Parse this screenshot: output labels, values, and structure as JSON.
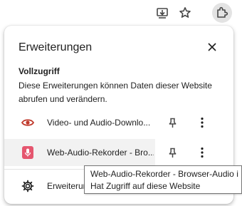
{
  "toolbar": {
    "buttons": [
      {
        "icon": "download-icon"
      },
      {
        "icon": "star-icon"
      },
      {
        "icon": "puzzle-icon"
      }
    ]
  },
  "panel": {
    "title": "Erweiterungen",
    "section_heading": "Vollzugriff",
    "section_description": "Diese Erweiterungen können Daten dieser Website abrufen und verändern.",
    "extensions": [
      {
        "name": "Video- und Audio-Downlo...",
        "icon": "eye-icon",
        "icon_color": "#c0392b"
      },
      {
        "name": "Web-Audio-Rekorder - Bro...",
        "icon": "microphone-icon",
        "icon_color": "#e5566f"
      }
    ],
    "manage_label": "Erweiterungen verwalten"
  },
  "tooltip": {
    "line1": "Web-Audio-Rekorder - Browser-Audio i",
    "line2": "Hat Zugriff auf diese Website"
  },
  "colors": {
    "active_button_bg": "#e3e3e3",
    "hover_row_bg": "#f2f2f2",
    "icon_gray": "#474747"
  }
}
